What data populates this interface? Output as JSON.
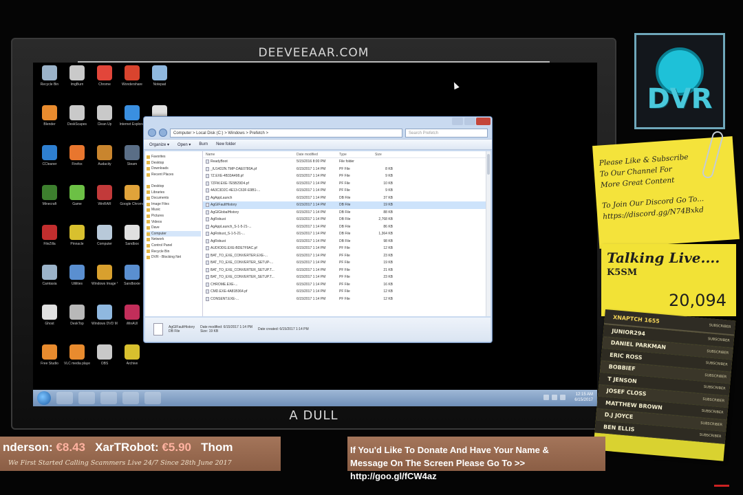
{
  "monitor": {
    "site": "DEEVEEAAR.COM",
    "label": "A DULL"
  },
  "desktop_icons": [
    {
      "label": "Recycle Bin",
      "icon": "recycle-bin-icon",
      "color": "#9bb3c9"
    },
    {
      "label": "ImgBurn",
      "icon": "disc-icon",
      "color": "#c9c9c9"
    },
    {
      "label": "Chrome",
      "icon": "chrome-icon",
      "color": "#e2463a"
    },
    {
      "label": "Wondershare",
      "icon": "app-icon",
      "color": "#d9442e"
    },
    {
      "label": "Notepad",
      "icon": "notepad-icon",
      "color": "#8fb8df"
    },
    {
      "label": "Blender",
      "icon": "blender-icon",
      "color": "#e88b2e"
    },
    {
      "label": "DeskScapes",
      "icon": "app-icon",
      "color": "#c9c9c9"
    },
    {
      "label": "Clean Up",
      "icon": "app-icon",
      "color": "#c9c9c9"
    },
    {
      "label": "Internet Explorer",
      "icon": "ie-icon",
      "color": "#3a8fe0"
    },
    {
      "label": "Paint",
      "icon": "paint-icon",
      "color": "#e0e0e0"
    },
    {
      "label": "CCleaner",
      "icon": "ccleaner-icon",
      "color": "#2e7fd0"
    },
    {
      "label": "Firefox",
      "icon": "firefox-icon",
      "color": "#e8762e"
    },
    {
      "label": "Audacity",
      "icon": "audio-icon",
      "color": "#c9852e"
    },
    {
      "label": "Steam",
      "icon": "steam-icon",
      "color": "#5a6e86"
    },
    {
      "label": "",
      "icon": "blank-icon",
      "color": "#000000"
    },
    {
      "label": "Minecraft",
      "icon": "minecraft-icon",
      "color": "#3d7f2e"
    },
    {
      "label": "Game",
      "icon": "app-icon",
      "color": "#6cc045"
    },
    {
      "label": "WinRAR",
      "icon": "archive-icon",
      "color": "#c23a3a"
    },
    {
      "label": "Google Chrome",
      "icon": "chrome-icon",
      "color": "#e0a33a"
    },
    {
      "label": "",
      "icon": "blank-icon",
      "color": "#000000"
    },
    {
      "label": "FileZilla",
      "icon": "filezilla-icon",
      "color": "#c22e2e"
    },
    {
      "label": "Pinnacle",
      "icon": "app-icon",
      "color": "#d8c02e"
    },
    {
      "label": "Computer",
      "icon": "computer-icon",
      "color": "#b8c9d9"
    },
    {
      "label": "Sandbox",
      "icon": "app-icon",
      "color": "#e0e0e0"
    },
    {
      "label": "",
      "icon": "blank-icon",
      "color": "#000000"
    },
    {
      "label": "Camtasia",
      "icon": "camtasia-icon",
      "color": "#9bb3c9"
    },
    {
      "label": "Utilities",
      "icon": "app-icon",
      "color": "#5a8fd0"
    },
    {
      "label": "Windows Image Viewer",
      "icon": "image-icon",
      "color": "#d8a02e"
    },
    {
      "label": "Sandboxie",
      "icon": "app-icon",
      "color": "#5a8fd0"
    },
    {
      "label": "",
      "icon": "blank-icon",
      "color": "#000000"
    },
    {
      "label": "Ghost",
      "icon": "ghost-icon",
      "color": "#e0e0e0"
    },
    {
      "label": "DeskTop",
      "icon": "app-icon",
      "color": "#b8b8b8"
    },
    {
      "label": "Windows DVD Maker",
      "icon": "dvd-icon",
      "color": "#8fb8df"
    },
    {
      "label": "WinAUI",
      "icon": "app-icon",
      "color": "#c22e5a"
    },
    {
      "label": "",
      "icon": "blank-icon",
      "color": "#000000"
    },
    {
      "label": "Free Studio",
      "icon": "app-icon",
      "color": "#e88b2e"
    },
    {
      "label": "VLC media player",
      "icon": "vlc-icon",
      "color": "#e88b2e"
    },
    {
      "label": "OBS",
      "icon": "megaphone-icon",
      "color": "#c9c9c9"
    },
    {
      "label": "Archive",
      "icon": "archive-icon",
      "color": "#d8c02e"
    }
  ],
  "explorer": {
    "address": "Computer > Local Disk (C:) > Windows > Prefetch >",
    "search_placeholder": "Search Prefetch",
    "toolbar": [
      "Organize ▾",
      "Open ▾",
      "Burn",
      "New folder"
    ],
    "nav_items": [
      {
        "label": "Favorites",
        "selected": false
      },
      {
        "label": "Desktop",
        "selected": false
      },
      {
        "label": "Downloads",
        "selected": false
      },
      {
        "label": "Recent Places",
        "selected": false
      },
      {
        "label": "",
        "selected": false
      },
      {
        "label": "Desktop",
        "selected": false
      },
      {
        "label": "Libraries",
        "selected": false
      },
      {
        "label": "Documents",
        "selected": false
      },
      {
        "label": "Image Files",
        "selected": false
      },
      {
        "label": "Music",
        "selected": false
      },
      {
        "label": "Pictures",
        "selected": false
      },
      {
        "label": "Videos",
        "selected": false
      },
      {
        "label": "Dave",
        "selected": false
      },
      {
        "label": "Computer",
        "selected": true
      },
      {
        "label": "Network",
        "selected": false
      },
      {
        "label": "Control Panel",
        "selected": false
      },
      {
        "label": "Recycle Bin",
        "selected": false
      },
      {
        "label": "DVR - Blocking Net",
        "selected": false
      }
    ],
    "columns": [
      "Name",
      "Date modified",
      "Type",
      "Size"
    ],
    "files": [
      {
        "name": "ReadyBoot",
        "date": "5/15/2016 8:00 PM",
        "type": "File folder",
        "size": "",
        "selected": false
      },
      {
        "name": "_IU14D2N.TMP-DAE0780A.pf",
        "date": "6/15/2017 1:14 PM",
        "type": "PF File",
        "size": "8 KB",
        "selected": false
      },
      {
        "name": "7Z.EXE-4B33A498.pf",
        "date": "6/15/2017 1:14 PM",
        "type": "PF File",
        "size": "9 KB",
        "selected": false
      },
      {
        "name": "7ZFM.EXE-7E5B29D4.pf",
        "date": "6/15/2017 1:14 PM",
        "type": "PF File",
        "size": "10 KB",
        "selected": false
      },
      {
        "name": "4A3C3D2C-4E13-C63F-E9B1-...",
        "date": "6/15/2017 1:14 PM",
        "type": "PF File",
        "size": "9 KB",
        "selected": false
      },
      {
        "name": "AgAppLaunch",
        "date": "6/15/2017 1:14 PM",
        "type": "DB File",
        "size": "37 KB",
        "selected": false
      },
      {
        "name": "AgGIFaultHistory",
        "date": "6/15/2017 1:14 PM",
        "type": "DB File",
        "size": "19 KB",
        "selected": true
      },
      {
        "name": "AgGlGlobalHistory",
        "date": "6/15/2017 1:14 PM",
        "type": "DB File",
        "size": "88 KB",
        "selected": false
      },
      {
        "name": "AgRobust",
        "date": "6/15/2017 1:14 PM",
        "type": "DB File",
        "size": "2,768 KB",
        "selected": false
      },
      {
        "name": "AgAppLaunch_S-1-5-21-...",
        "date": "6/15/2017 1:14 PM",
        "type": "DB File",
        "size": "86 KB",
        "selected": false
      },
      {
        "name": "AgRobust_S-1-5-21-...",
        "date": "6/15/2017 1:14 PM",
        "type": "DB File",
        "size": "1,364 KB",
        "selected": false
      },
      {
        "name": "AgRobust",
        "date": "6/15/2017 1:14 PM",
        "type": "DB File",
        "size": "98 KB",
        "selected": false
      },
      {
        "name": "AUDIODG.EXE-BDE7F9AC.pf",
        "date": "6/15/2017 1:14 PM",
        "type": "PF File",
        "size": "12 KB",
        "selected": false
      },
      {
        "name": "BAT_TO_EXE_CONVERTER.EXE-...",
        "date": "6/15/2017 1:14 PM",
        "type": "PF File",
        "size": "23 KB",
        "selected": false
      },
      {
        "name": "BAT_TO_EXE_CONVERTER_SETUP-...",
        "date": "6/15/2017 1:14 PM",
        "type": "PF File",
        "size": "19 KB",
        "selected": false
      },
      {
        "name": "BAT_TO_EXE_CONVERTER_SETUP.T...",
        "date": "6/15/2017 1:14 PM",
        "type": "PF File",
        "size": "21 KB",
        "selected": false
      },
      {
        "name": "BAT_TO_EXE_CONVERTER_SETUP.T...",
        "date": "6/15/2017 1:14 PM",
        "type": "PF File",
        "size": "23 KB",
        "selected": false
      },
      {
        "name": "CHROME.EXE-...",
        "date": "6/15/2017 1:14 PM",
        "type": "PF File",
        "size": "16 KB",
        "selected": false
      },
      {
        "name": "CMD.EXE-4A81B364.pf",
        "date": "6/15/2017 1:14 PM",
        "type": "PF File",
        "size": "12 KB",
        "selected": false
      },
      {
        "name": "CONSENT.EXE-...",
        "date": "6/15/2017 1:14 PM",
        "type": "PF File",
        "size": "12 KB",
        "selected": false
      }
    ],
    "details": {
      "name": "AgGIFaultHistory",
      "line1": "Date modified: 6/15/2017 1:14 PM",
      "line2": "Size: 19 KB",
      "line3": "Date created: 6/15/2017 1:14 PM",
      "kind": "DB File"
    }
  },
  "taskbar": {
    "time": "12:15 AM",
    "date": "6/15/2017"
  },
  "logo": {
    "text": "DVR"
  },
  "note1": {
    "line1": "Please Like & Subscribe",
    "line2": "To Our Channel For",
    "line3": "More Great Content",
    "line4": "To Join Our Discord Go To...",
    "line5": "https://discord.gg/N74Bxkd"
  },
  "talking_live": {
    "title": "Talking Live....",
    "user": "K5SM",
    "count": "20,094"
  },
  "leaderboard": {
    "header": "XNAPTCH 1655",
    "header_tag": "SUBSCRIBER",
    "rows": [
      {
        "name": "JUNIOR294",
        "tag": "SUBSCRIBER"
      },
      {
        "name": "DANIEL PARKMAN",
        "tag": "SUBSCRIBER"
      },
      {
        "name": "ERIC ROSS",
        "tag": "SUBSCRIBER"
      },
      {
        "name": "BOBBIEF",
        "tag": "SUBSCRIBER"
      },
      {
        "name": "T JENSON",
        "tag": "SUBSCRIBER"
      },
      {
        "name": "JOSEF CLOSS",
        "tag": "SUBSCRIBER"
      },
      {
        "name": "MATTHEW BROWN",
        "tag": "SUBSCRIBER"
      },
      {
        "name": "D.J JOYCE",
        "tag": "SUBSCRIBER"
      },
      {
        "name": "BEN ELLIS",
        "tag": "SUBSCRIBER"
      }
    ]
  },
  "ticker": {
    "part1": "nderson: ",
    "amt1": "€8.43",
    "part2": "XarTRobot: ",
    "amt2": "€5.90",
    "part3": "Thom",
    "sub": "We First Started Calling Scammers Live 24/7 Since 28th June 2017"
  },
  "donate": {
    "line1": "If You'd Like To Donate And Have Your Name &",
    "line2": "Message On The Screen Please Go To >> http://goo.gl/fCW4az"
  }
}
